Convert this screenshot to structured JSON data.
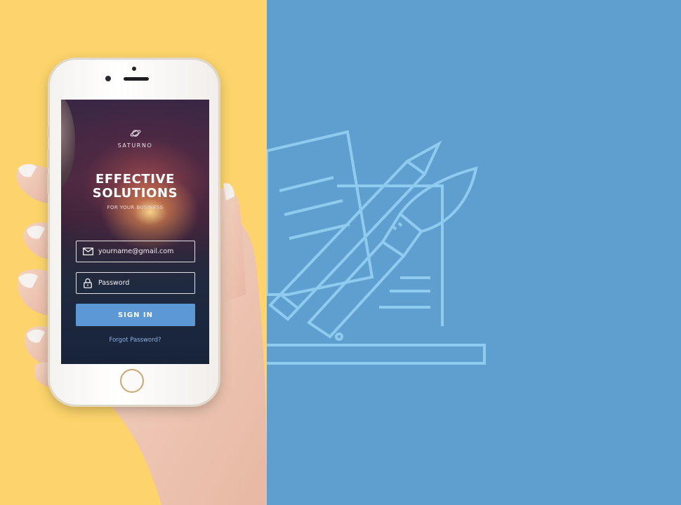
{
  "app": {
    "brand": "SATURNO",
    "headline_line1": "EFFECTIVE",
    "headline_line2": "SOLUTIONS",
    "subheadline": "FOR YOUR BUSINESS"
  },
  "login": {
    "email_placeholder": "yourname@gmail.com",
    "password_placeholder": "Password",
    "signin_label": "SIGN IN",
    "forgot_label": "Forgot Password?"
  },
  "icons": {
    "logo": "planet-icon",
    "email": "envelope-icon",
    "password": "lock-icon",
    "illustration": "laptop-pencil-brush-illustration"
  },
  "colors": {
    "left_background": "#fcd46b",
    "right_background": "#5f9fcf",
    "button": "#5b98d4",
    "link": "#8fb3e3",
    "illustration_stroke": "#8fcbef"
  }
}
